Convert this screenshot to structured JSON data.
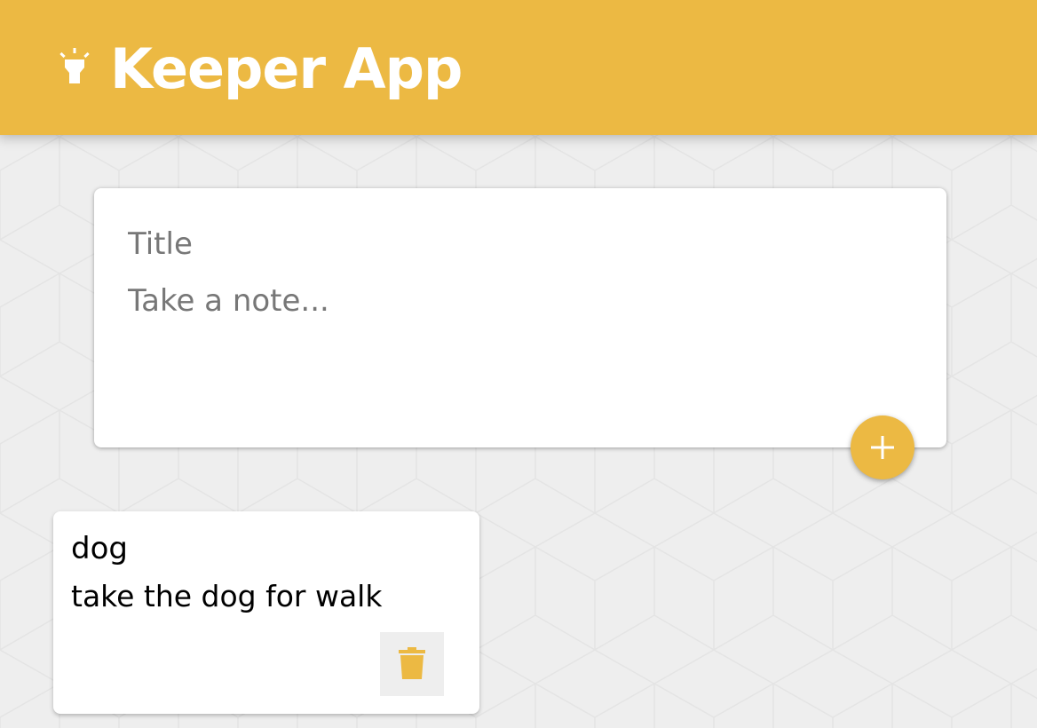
{
  "header": {
    "title": "Keeper App",
    "icon": "lightbulb-icon"
  },
  "create_area": {
    "title_placeholder": "Title",
    "content_placeholder": "Take a note...",
    "title_value": "",
    "content_value": "",
    "add_icon": "plus-icon"
  },
  "notes": [
    {
      "title": "dog",
      "content": "take the dog for walk",
      "delete_icon": "trash-icon"
    }
  ],
  "colors": {
    "accent": "#ecb943",
    "background": "#eeeeee",
    "card": "#ffffff"
  }
}
